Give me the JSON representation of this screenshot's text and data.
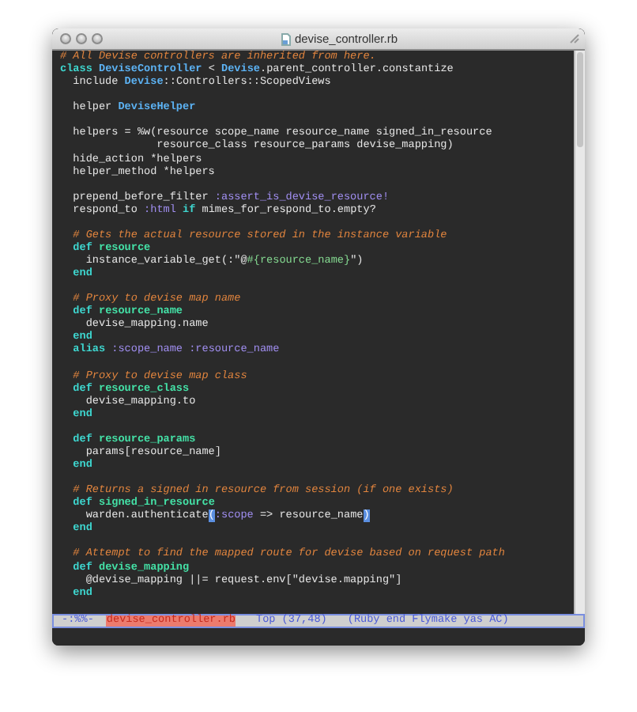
{
  "window": {
    "title": "devise_controller.rb"
  },
  "editor": {
    "blocks": [
      {
        "lines": [
          {
            "segments": [
              {
                "kind": "comment",
                "text": "# All Devise controllers are inherited from here."
              }
            ]
          },
          {
            "segments": [
              {
                "kind": "keyword",
                "text": "class "
              },
              {
                "kind": "constant",
                "text": "DeviseController"
              },
              {
                "kind": "plain",
                "text": " < "
              },
              {
                "kind": "constant",
                "text": "Devise"
              },
              {
                "kind": "plain",
                "text": ".parent_controller.constantize"
              }
            ]
          },
          {
            "segments": [
              {
                "kind": "plain",
                "text": "  include "
              },
              {
                "kind": "constant",
                "text": "Devise"
              },
              {
                "kind": "plain",
                "text": "::Controllers::ScopedViews"
              }
            ]
          }
        ]
      },
      {
        "lines": [
          {
            "segments": [
              {
                "kind": "plain",
                "text": "  helper "
              },
              {
                "kind": "constant",
                "text": "DeviseHelper"
              }
            ]
          }
        ]
      },
      {
        "lines": [
          {
            "segments": [
              {
                "kind": "plain",
                "text": "  helpers = %w(resource scope_name resource_name signed_in_resource"
              }
            ]
          },
          {
            "segments": [
              {
                "kind": "plain",
                "text": "               resource_class resource_params devise_mapping)"
              }
            ]
          },
          {
            "segments": [
              {
                "kind": "plain",
                "text": "  hide_action *helpers"
              }
            ]
          },
          {
            "segments": [
              {
                "kind": "plain",
                "text": "  helper_method *helpers"
              }
            ]
          }
        ]
      },
      {
        "lines": [
          {
            "segments": [
              {
                "kind": "plain",
                "text": "  prepend_before_filter "
              },
              {
                "kind": "symbol",
                "text": ":assert_is_devise_resource!"
              }
            ]
          },
          {
            "segments": [
              {
                "kind": "plain",
                "text": "  respond_to "
              },
              {
                "kind": "symbol",
                "text": ":html "
              },
              {
                "kind": "keyword",
                "text": "if"
              },
              {
                "kind": "plain",
                "text": " mimes_for_respond_to.empty?"
              }
            ]
          }
        ]
      },
      {
        "lines": [
          {
            "segments": [
              {
                "kind": "comment",
                "text": "  # Gets the actual resource stored in the instance variable"
              }
            ]
          },
          {
            "segments": [
              {
                "kind": "keyword",
                "text": "  def "
              },
              {
                "kind": "defname",
                "text": "resource"
              }
            ]
          },
          {
            "segments": [
              {
                "kind": "plain",
                "text": "    instance_variable_get(:\"@"
              },
              {
                "kind": "string",
                "text": "#{resource_name}"
              },
              {
                "kind": "plain",
                "text": "\")"
              }
            ]
          },
          {
            "segments": [
              {
                "kind": "keyword",
                "text": "  end"
              }
            ]
          }
        ]
      },
      {
        "lines": [
          {
            "segments": [
              {
                "kind": "comment",
                "text": "  # Proxy to devise map name"
              }
            ]
          },
          {
            "segments": [
              {
                "kind": "keyword",
                "text": "  def "
              },
              {
                "kind": "defname",
                "text": "resource_name"
              }
            ]
          },
          {
            "segments": [
              {
                "kind": "plain",
                "text": "    devise_mapping.name"
              }
            ]
          },
          {
            "segments": [
              {
                "kind": "keyword",
                "text": "  end"
              }
            ]
          },
          {
            "segments": [
              {
                "kind": "keyword",
                "text": "  alias "
              },
              {
                "kind": "symbol",
                "text": ":scope_name :resource_name"
              }
            ]
          }
        ]
      },
      {
        "lines": [
          {
            "segments": [
              {
                "kind": "comment",
                "text": "  # Proxy to devise map class"
              }
            ]
          },
          {
            "segments": [
              {
                "kind": "keyword",
                "text": "  def "
              },
              {
                "kind": "defname",
                "text": "resource_class"
              }
            ]
          },
          {
            "segments": [
              {
                "kind": "plain",
                "text": "    devise_mapping.to"
              }
            ]
          },
          {
            "segments": [
              {
                "kind": "keyword",
                "text": "  end"
              }
            ]
          }
        ]
      },
      {
        "lines": [
          {
            "segments": [
              {
                "kind": "keyword",
                "text": "  def "
              },
              {
                "kind": "defname",
                "text": "resource_params"
              }
            ]
          },
          {
            "segments": [
              {
                "kind": "plain",
                "text": "    params[resource_name]"
              }
            ]
          },
          {
            "segments": [
              {
                "kind": "keyword",
                "text": "  end"
              }
            ]
          }
        ]
      },
      {
        "lines": [
          {
            "segments": [
              {
                "kind": "comment",
                "text": "  # Returns a signed in resource from session (if one exists)"
              }
            ]
          },
          {
            "segments": [
              {
                "kind": "keyword",
                "text": "  def "
              },
              {
                "kind": "defname",
                "text": "signed_in_resource"
              }
            ]
          },
          {
            "segments": [
              {
                "kind": "plain",
                "text": "    warden.authenticate"
              },
              {
                "kind": "match",
                "text": "("
              },
              {
                "kind": "symbol",
                "text": ":scope"
              },
              {
                "kind": "plain",
                "text": " => resource_name"
              },
              {
                "kind": "match",
                "text": ")"
              }
            ]
          },
          {
            "segments": [
              {
                "kind": "keyword",
                "text": "  end"
              }
            ]
          }
        ]
      },
      {
        "lines": [
          {
            "segments": [
              {
                "kind": "comment",
                "text": "  # Attempt to find the mapped route for devise based on request path"
              }
            ]
          },
          {
            "segments": [
              {
                "kind": "keyword",
                "text": "  def "
              },
              {
                "kind": "defname",
                "text": "devise_mapping"
              }
            ]
          },
          {
            "segments": [
              {
                "kind": "plain",
                "text": "    @devise_mapping ||= request.env[\"devise.mapping\"]"
              }
            ]
          },
          {
            "segments": [
              {
                "kind": "keyword",
                "text": "  end"
              }
            ]
          }
        ]
      }
    ]
  },
  "mode_line": {
    "flags": "-:%%-",
    "buffer": "devise_controller.rb",
    "position": "Top (37,48)",
    "modes": "(Ruby end Flymake yas AC)"
  }
}
